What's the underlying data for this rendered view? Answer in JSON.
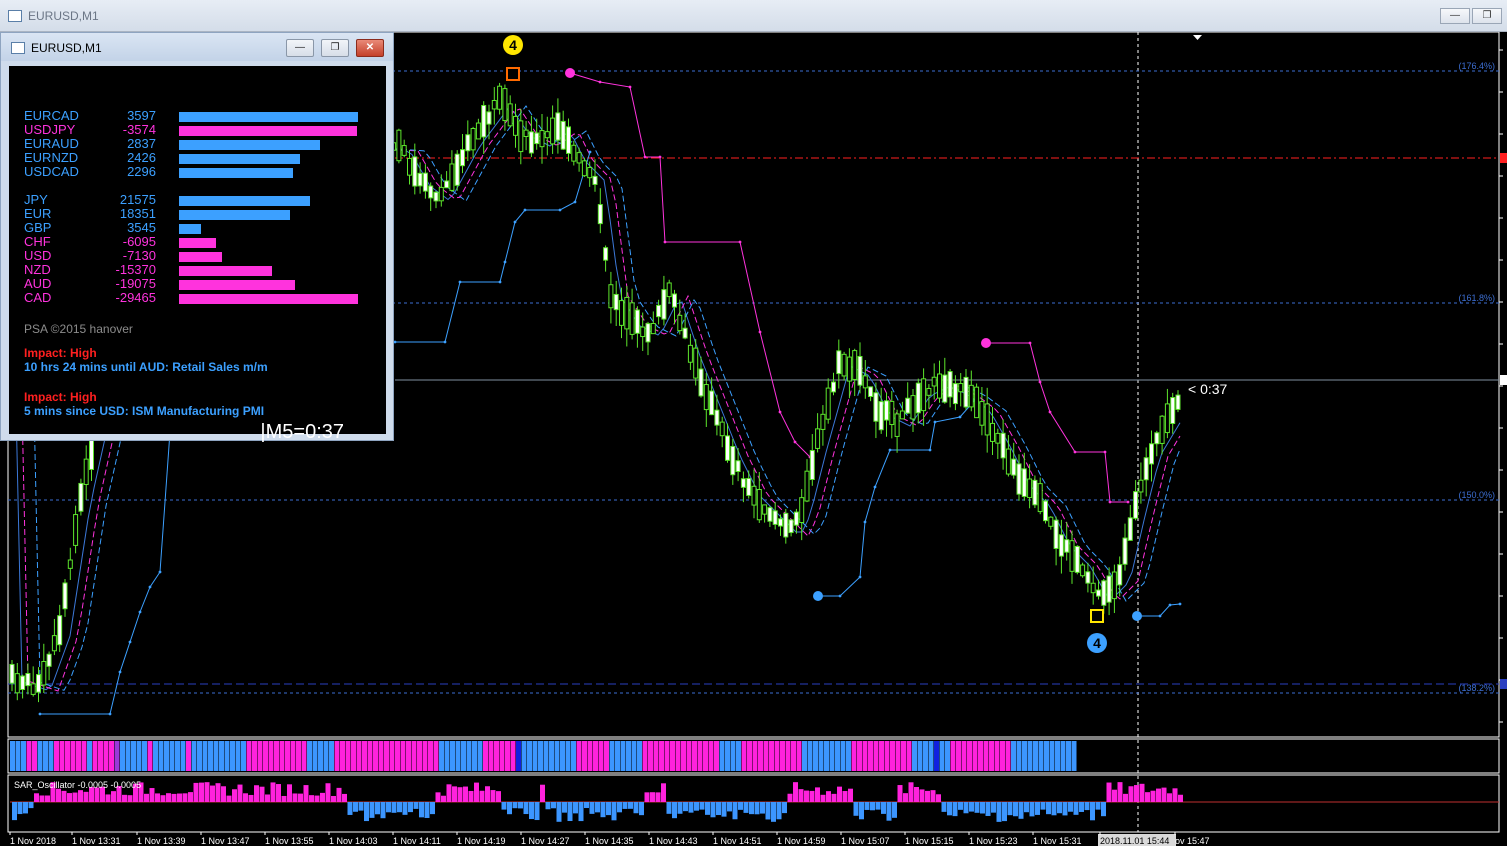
{
  "window": {
    "title": "EURUSD,M1",
    "minimize": "—",
    "restore": "❐",
    "close": "✕"
  },
  "panel": {
    "title": "EURUSD,M1",
    "pairs": [
      {
        "symbol": "EURCAD",
        "value": "3597",
        "color": "#3ca0ff",
        "strength": 3597
      },
      {
        "symbol": "USDJPY",
        "value": "-3574",
        "color": "#ff33dd",
        "strength": -3574
      },
      {
        "symbol": "EURAUD",
        "value": "2837",
        "color": "#3ca0ff",
        "strength": 2837
      },
      {
        "symbol": "EURNZD",
        "value": "2426",
        "color": "#3ca0ff",
        "strength": 2426
      },
      {
        "symbol": "USDCAD",
        "value": "2296",
        "color": "#3ca0ff",
        "strength": 2296
      }
    ],
    "currencies": [
      {
        "symbol": "JPY",
        "value": "21575",
        "color": "#3ca0ff",
        "strength": 21575
      },
      {
        "symbol": "EUR",
        "value": "18351",
        "color": "#3ca0ff",
        "strength": 18351
      },
      {
        "symbol": "GBP",
        "value": "3545",
        "color": "#3ca0ff",
        "strength": 3545
      },
      {
        "symbol": "CHF",
        "value": "-6095",
        "color": "#ff33dd",
        "strength": -6095
      },
      {
        "symbol": "USD",
        "value": "-7130",
        "color": "#ff33dd",
        "strength": -7130
      },
      {
        "symbol": "NZD",
        "value": "-15370",
        "color": "#ff33dd",
        "strength": -15370
      },
      {
        "symbol": "AUD",
        "value": "-19075",
        "color": "#ff33dd",
        "strength": -19075
      },
      {
        "symbol": "CAD",
        "value": "-29465",
        "color": "#ff33dd",
        "strength": -29465
      }
    ],
    "credit": "PSA ©2015 hanover",
    "news": [
      {
        "impact": "Impact: High",
        "event": "10 hrs 24 mins until AUD: Retail Sales m/m"
      },
      {
        "impact": "Impact: High",
        "event": "5 mins since USD: ISM Manufacturing PMI"
      }
    ],
    "timer": "|M5=0:37"
  },
  "chart": {
    "fib_levels": [
      "(176.4%)",
      "(161.8%)",
      "(150.0%)",
      "(138.2%)"
    ],
    "countdown": "< 0:37",
    "top_marker": "4",
    "bottom_marker": "4",
    "oscillator_label": "SAR_Oscillator -0.0005 -0.0005",
    "time_labels": [
      "1 Nov 2018",
      "1 Nov 13:31",
      "1 Nov 13:39",
      "1 Nov 13:47",
      "1 Nov 13:55",
      "1 Nov 14:03",
      "1 Nov 14:11",
      "1 Nov 14:19",
      "1 Nov 14:27",
      "1 Nov 14:35",
      "1 Nov 14:43",
      "1 Nov 14:51",
      "1 Nov 14:59",
      "1 Nov 15:07",
      "1 Nov 15:15",
      "1 Nov 15:23",
      "1 Nov 15:31",
      "2018.11.01 15:44",
      "ov 15:47"
    ],
    "colors": {
      "candle": "#5de62c",
      "sar_bull": "#3ca0ff",
      "sar_bear": "#ff33dd",
      "fib": "#3c6ed2",
      "red_line": "#ff2020",
      "marker_yellow": "#ffe600"
    }
  }
}
